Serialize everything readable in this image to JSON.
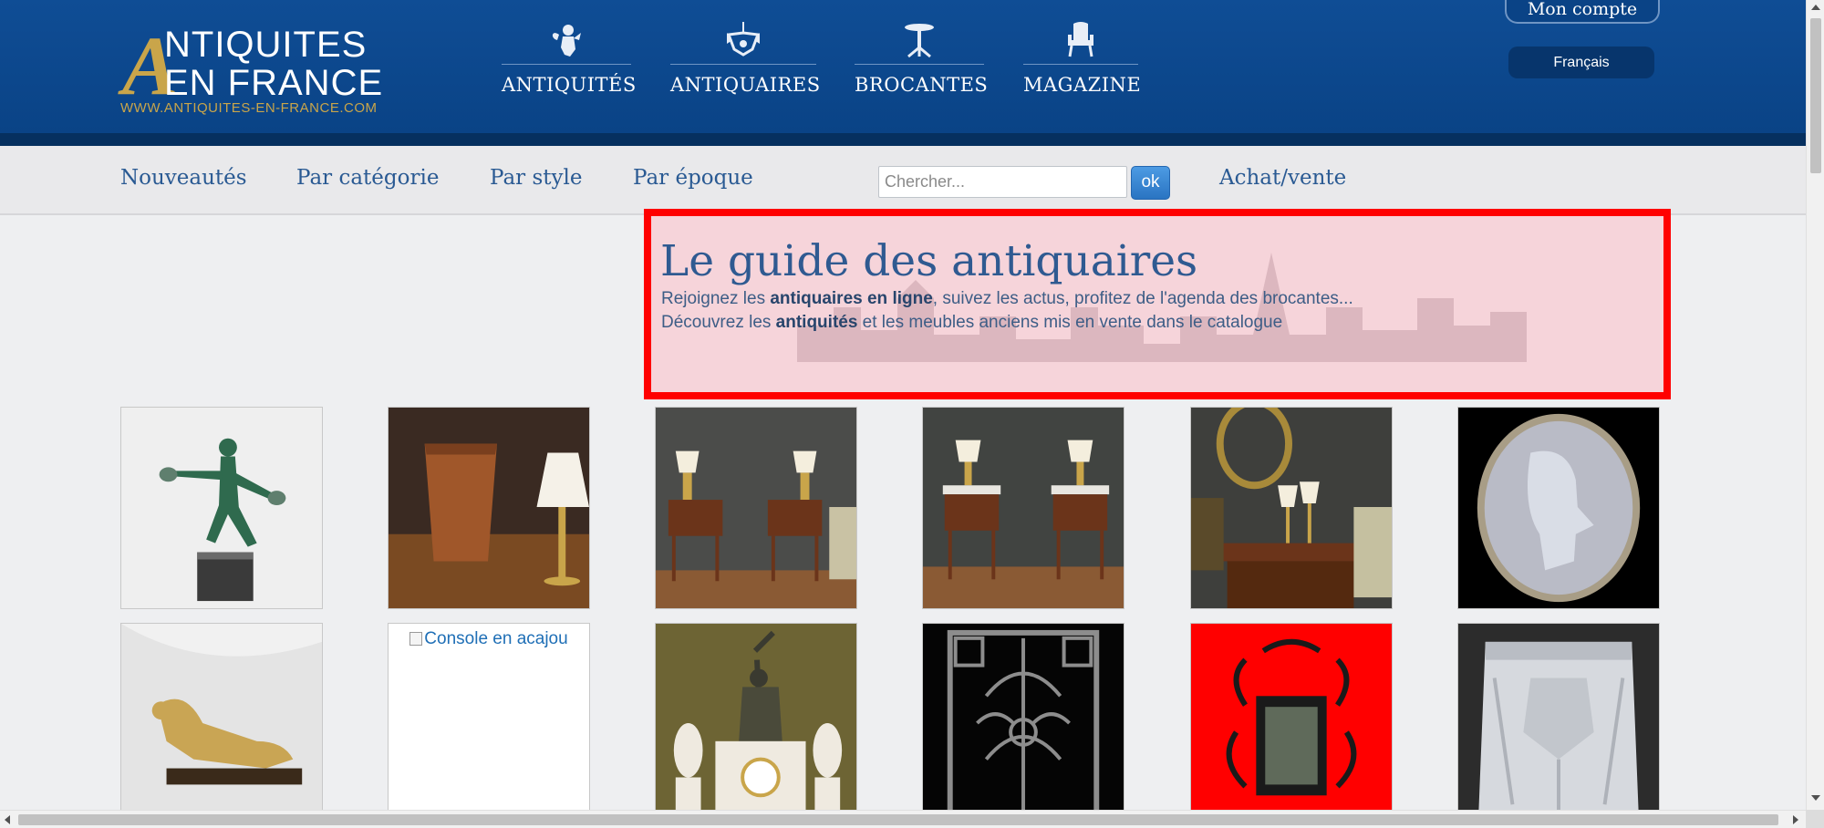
{
  "logo": {
    "letter": "A",
    "line1": "NTIQUITES",
    "line2": "EN FRANCE",
    "url": "WWW.ANTIQUITES-EN-FRANCE.COM"
  },
  "topnav": [
    {
      "label": "ANTIQUITÉS",
      "icon": "cherub-icon"
    },
    {
      "label": "ANTIQUAIRES",
      "icon": "chandelier-icon"
    },
    {
      "label": "BROCANTES",
      "icon": "pedestal-table-icon"
    },
    {
      "label": "MAGAZINE",
      "icon": "armchair-icon"
    }
  ],
  "account": {
    "label": "Mon compte"
  },
  "language": {
    "label": "Français"
  },
  "subnav": {
    "items": [
      "Nouveautés",
      "Par catégorie",
      "Par style",
      "Par époque"
    ],
    "achat": "Achat/vente"
  },
  "search": {
    "placeholder": "Chercher...",
    "button": "ok"
  },
  "hero": {
    "title": "Le guide des antiquaires",
    "line1": {
      "pre": "Rejoignez les ",
      "bold": "antiquaires en ligne",
      "post": ", suivez les actus, profitez de l'agenda des brocantes..."
    },
    "line2": {
      "pre": "Découvrez les ",
      "bold": "antiquités",
      "post": " et les meubles anciens mis en vente dans le catalogue"
    }
  },
  "gallery": {
    "row1": [
      "bronze-dancer-statue",
      "wood-planter",
      "pair-of-nightstands",
      "nightstands-marble-top",
      "nightstand-lamps",
      "glass-cameo-medallion"
    ],
    "row2": [
      "gilt-greyhound-sculpture",
      "console-broken-image",
      "clock-garniture-set",
      "iron-grille-panel",
      "wrought-iron-lantern",
      "frosted-glass-lampshade"
    ],
    "broken_alt": "Console en acajou"
  },
  "colors": {
    "header_blue": "#0f4d95",
    "gold": "#c9a54a",
    "link_blue": "#2a5a93",
    "highlight_border": "#ff0000"
  }
}
